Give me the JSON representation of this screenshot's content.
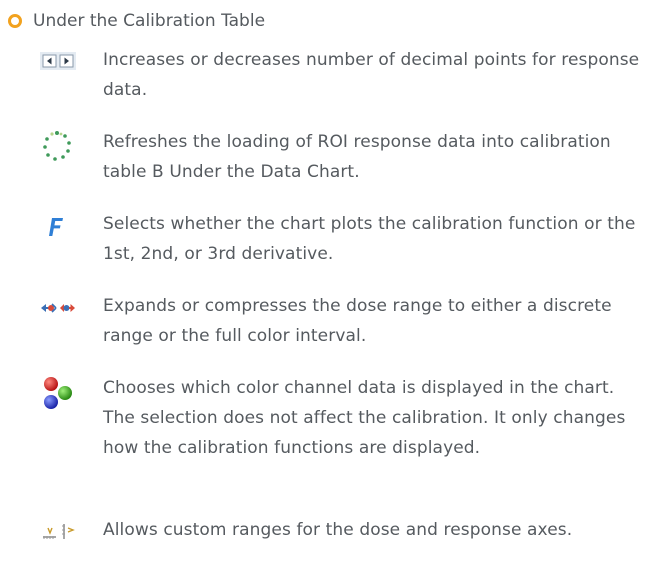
{
  "heading": "Under the Calibration Table",
  "entries": [
    {
      "icon": "decimal-points-arrows-icon",
      "text": "Increases or decreases number of decimal points for response data."
    },
    {
      "icon": "refresh-dots-icon",
      "text": "Refreshes the loading of ROI response data into calibration table B Under the Data Chart."
    },
    {
      "icon": "function-f-icon",
      "icon_glyph": "F",
      "text": "Selects whether the chart plots the calibration function or the 1st, 2nd, or 3rd derivative."
    },
    {
      "icon": "expand-compress-range-icon",
      "text": "Expands or compresses the dose range to either a discrete range or the full color interval."
    },
    {
      "icon": "color-channels-icon",
      "text": "Chooses which color channel data is displayed in the chart. The selection does not affect the calibration. It only changes how the calibration functions are displayed."
    },
    {
      "icon": "custom-axis-range-icon",
      "text": "Allows custom ranges for the dose and response axes."
    }
  ],
  "colors": {
    "bullet": "#f2a21f",
    "text": "#555a5f",
    "f_icon": "#2f7fd6",
    "red_channel": "#d42a2a",
    "green_channel": "#3fae2a",
    "blue_channel": "#2a3fd4"
  }
}
